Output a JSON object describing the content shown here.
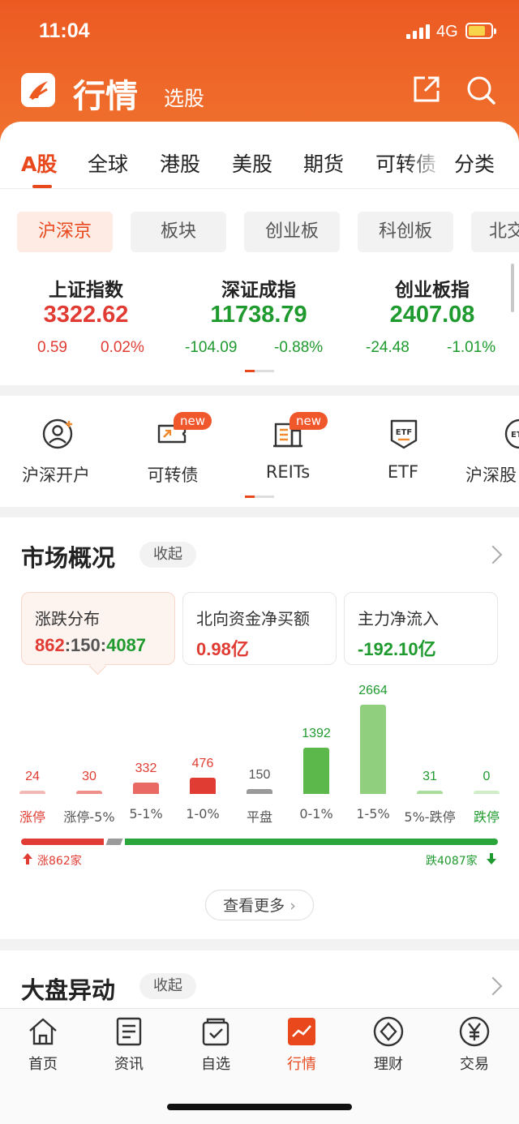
{
  "status": {
    "time": "11:04",
    "network": "4G"
  },
  "header": {
    "title": "行情",
    "subtitle": "选股"
  },
  "tabs": [
    "A股",
    "全球",
    "港股",
    "美股",
    "期货",
    "可转债",
    "分类"
  ],
  "chips": [
    "沪深京",
    "板块",
    "创业板",
    "科创板",
    "北交"
  ],
  "indices": [
    {
      "name": "上证指数",
      "value": "3322.62",
      "change": "0.59",
      "pct": "0.02%",
      "trend": "up"
    },
    {
      "name": "深证成指",
      "value": "11738.79",
      "change": "-104.09",
      "pct": "-0.88%",
      "trend": "down"
    },
    {
      "name": "创业板指",
      "value": "2407.08",
      "change": "-24.48",
      "pct": "-1.01%",
      "trend": "down"
    }
  ],
  "quick_entries": [
    {
      "label": "沪深开户",
      "icon": "account-user-icon",
      "badge": ""
    },
    {
      "label": "可转债",
      "icon": "convertible-bond-icon",
      "badge": "new"
    },
    {
      "label": "REITs",
      "icon": "reits-building-icon",
      "badge": "new"
    },
    {
      "label": "ETF",
      "icon": "etf-icon",
      "badge": ""
    },
    {
      "label": "沪深股",
      "icon": "etf-icon",
      "badge": ""
    }
  ],
  "market_overview": {
    "title": "市场概况",
    "collapse_label": "收起",
    "cards": [
      {
        "label": "涨跌分布",
        "up": "862",
        "flat": "150",
        "down": "4087"
      },
      {
        "label": "北向资金净买额",
        "value": "0.98亿"
      },
      {
        "label": "主力净流入",
        "value": "-192.10亿"
      }
    ],
    "up_label": "涨862家",
    "down_label": "跌4087家",
    "more_label": "查看更多"
  },
  "chart_data": {
    "type": "bar",
    "categories": [
      "涨停",
      "涨停-5%",
      "5-1%",
      "1-0%",
      "平盘",
      "0-1%",
      "1-5%",
      "5%-跌停",
      "跌停"
    ],
    "values": [
      24,
      30,
      332,
      476,
      150,
      1392,
      2664,
      31,
      0
    ],
    "colors": [
      "#f2b9b4",
      "#ee8f88",
      "#e86a63",
      "#e03c33",
      "#9a9a9a",
      "#5cb84a",
      "#8fcf7d",
      "#a9dd9c",
      "#cfeec8"
    ],
    "label_colors": [
      "#e03c33",
      "#e03c33",
      "#e03c33",
      "#e03c33",
      "#555555",
      "#1f9a2e",
      "#1f9a2e",
      "#1f9a2e",
      "#1f9a2e"
    ]
  },
  "section2": {
    "title": "大盘异动",
    "collapse_label": "收起"
  },
  "bottom_nav": [
    {
      "label": "首页",
      "icon": "home-icon"
    },
    {
      "label": "资讯",
      "icon": "news-icon"
    },
    {
      "label": "自选",
      "icon": "watchlist-icon"
    },
    {
      "label": "行情",
      "icon": "market-chart-icon"
    },
    {
      "label": "理财",
      "icon": "wealth-icon"
    },
    {
      "label": "交易",
      "icon": "trade-yen-icon"
    }
  ],
  "colors": {
    "accent": "#e8481c",
    "up": "#e03c33",
    "down": "#1f9a2e"
  }
}
